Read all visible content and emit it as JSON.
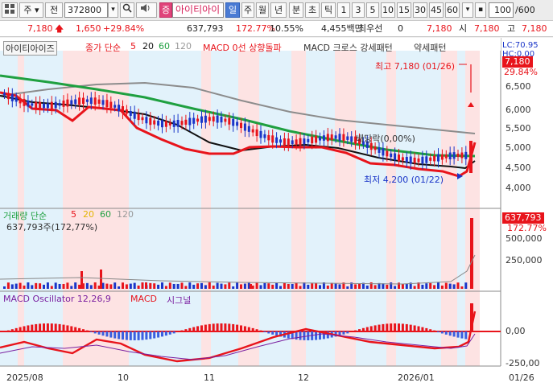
{
  "toolbar": {
    "menu_icon": "grid-menu-icon",
    "market_select": "주",
    "period_select": "전",
    "code_value": "372800",
    "search_icon": "magnifier-icon",
    "sound_icon": "speaker-icon",
    "theme_badge": "증",
    "stock_name": "아이티아이",
    "tabs": [
      "일",
      "주",
      "월",
      "년",
      "분",
      "초",
      "틱"
    ],
    "active_tab": "일",
    "intervals": [
      "1",
      "3",
      "5",
      "10",
      "15",
      "30",
      "45",
      "60"
    ],
    "count_value": "100",
    "count_max": "/600"
  },
  "quote": {
    "price": "7,180",
    "change": "1,650",
    "change_pct": "+29.84%",
    "volume": "637,793",
    "volume_ratio": "172.77%",
    "turnover_rate": "10.55%",
    "amount": "4,455백만",
    "priority_label": "최우선",
    "priority_value": "0",
    "ask": "7,180",
    "open_label": "시",
    "open": "7,180",
    "high_label": "고",
    "high": "7,180"
  },
  "price_panel": {
    "title": "아이티아이즈",
    "indicator": "종가 단순",
    "ma_periods": [
      "5",
      "20",
      "60",
      "120"
    ],
    "signal1": "MACD 0선 상향돌파",
    "signal2": "MACD 크로스 강세패턴",
    "signal3": "약세패턴",
    "lc": "LC:70.95",
    "hc": "HC:0.00",
    "current_tag": "7,180",
    "current_pct": "29.84%",
    "high_note": "최고 7,180 (01/26)",
    "low_note": "최저 4,200 (01/22)",
    "dividend_note": "배당락(0,00%)",
    "yticks": [
      "6,500",
      "6,000",
      "5,500",
      "5,000",
      "4,500",
      "4,000"
    ]
  },
  "volume_panel": {
    "title": "거래량 단순",
    "ma_periods": [
      "5",
      "20",
      "60",
      "120"
    ],
    "value_text": "637,793주(172,77%)",
    "current_tag": "637,793",
    "current_pct": "172.77%",
    "yticks": [
      "500,000",
      "250,000"
    ]
  },
  "macd_panel": {
    "title": "MACD Oscillator 12,26,9",
    "legend_macd": "MACD",
    "legend_signal": "시그널",
    "yticks": [
      "0,00",
      "-250,00"
    ]
  },
  "xaxis": {
    "labels": [
      "2025/08",
      "10",
      "11",
      "12",
      "2026/01"
    ],
    "last_date": "01/26"
  },
  "colors": {
    "up": "#e8141b",
    "down": "#1a35c8",
    "ma5": "#e8141b",
    "ma20": "#111111",
    "ma60": "#1fa040",
    "ma120": "#8c8c8c",
    "band_pink": "#fde3e3",
    "band_blue": "#e2f2fb"
  }
}
